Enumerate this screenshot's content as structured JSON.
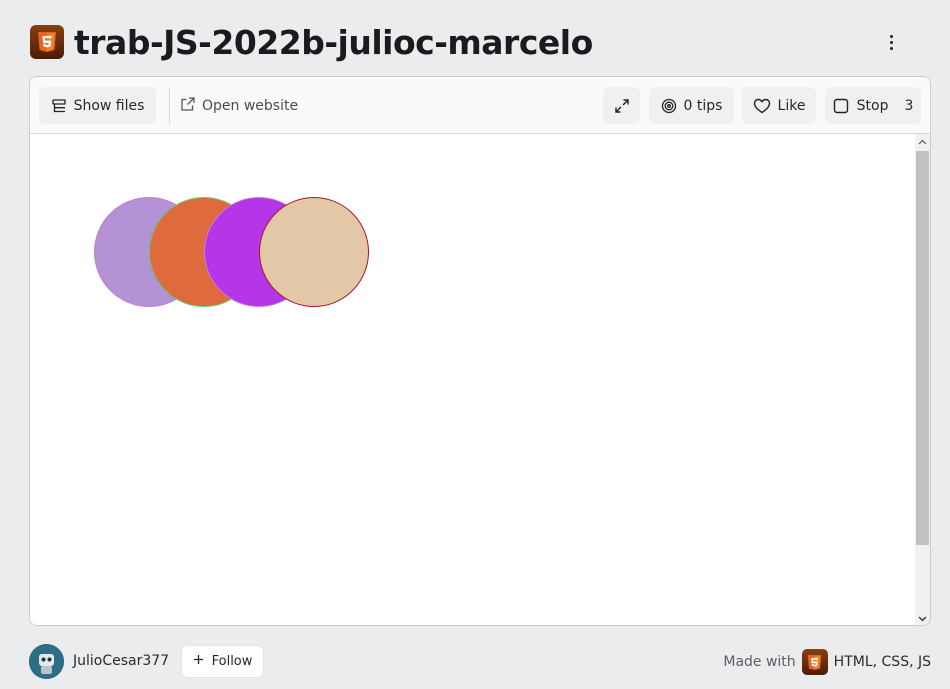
{
  "header": {
    "title": "trab-JS-2022b-julioc-marcelo",
    "logo_icon": "html5-icon",
    "menu_icon": "kebab-menu-icon"
  },
  "toolbar": {
    "show_files_label": "Show files",
    "open_website_label": "Open website",
    "tips_label": "0 tips",
    "like_label": "Like",
    "stop_label": "Stop",
    "stop_count": "3"
  },
  "preview": {
    "circles": [
      {
        "fill": "#b392d6",
        "stroke": "#c27dd0"
      },
      {
        "fill": "#df6a3e",
        "stroke": "#63c763"
      },
      {
        "fill": "#b536e6",
        "stroke": "#c07ed2"
      },
      {
        "fill": "#e3c8a8",
        "stroke": "#a5182c"
      }
    ]
  },
  "footer": {
    "username": "JulioCesar377",
    "follow_label": "Follow",
    "made_with_label": "Made with",
    "tech_label": "HTML, CSS, JS"
  },
  "colors": {
    "page_background": "#ebecee",
    "html5_brand": "#e8641e"
  }
}
